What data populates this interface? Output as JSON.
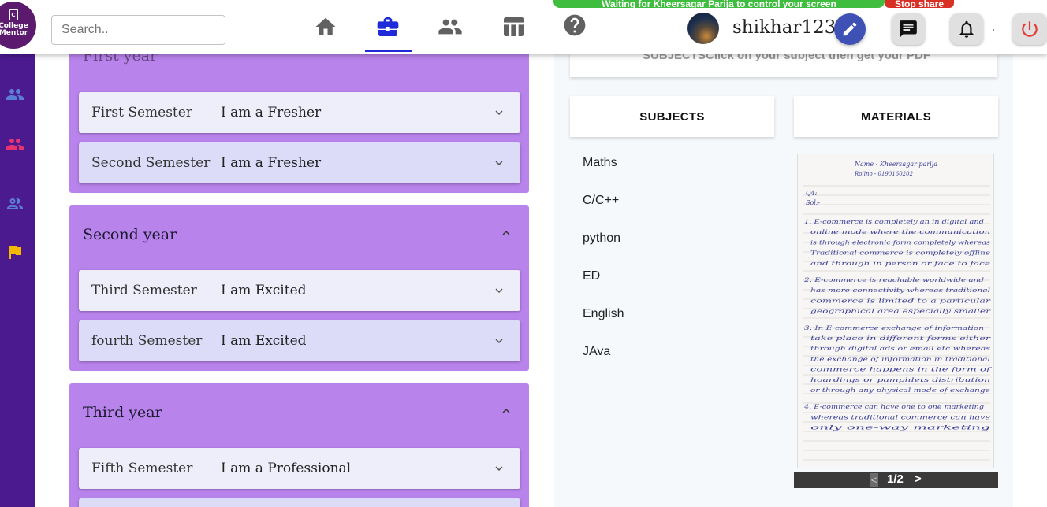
{
  "brand": {
    "logo_text": "College Mentor",
    "logo_line1": "College",
    "logo_line2": "Mentor"
  },
  "search": {
    "placeholder": "Search.."
  },
  "nav": {
    "items": [
      {
        "icon": "home-icon",
        "active": false
      },
      {
        "icon": "briefcase-icon",
        "active": true
      },
      {
        "icon": "people-icon",
        "active": false
      },
      {
        "icon": "dashboard-icon",
        "active": false
      },
      {
        "icon": "help-icon",
        "active": false
      }
    ]
  },
  "screen_share": {
    "message": "Waiting for Kheersagar Parija to control your screen",
    "stop_label": "Stop share"
  },
  "user": {
    "name": "shikhar123"
  },
  "header_actions": [
    "edit-icon",
    "chat-icon",
    "bell-icon",
    "power-icon"
  ],
  "sidebar": {
    "icons": [
      "group-icon",
      "group-icon",
      "group-outline-icon",
      "flag-icon"
    ]
  },
  "years": [
    {
      "title": "First year",
      "expanded": true,
      "semesters": [
        {
          "name": "First Semester",
          "status": "I am a Fresher"
        },
        {
          "name": "Second Semester",
          "status": "I am a Fresher"
        }
      ]
    },
    {
      "title": "Second year",
      "expanded": true,
      "semesters": [
        {
          "name": "Third Semester",
          "status": "I am Excited"
        },
        {
          "name": "fourth Semester",
          "status": "I am Excited"
        }
      ]
    },
    {
      "title": "Third year",
      "expanded": true,
      "semesters": [
        {
          "name": "Fifth Semester",
          "status": "I am a Professional"
        }
      ]
    }
  ],
  "right_panel": {
    "hint": "SUBJECTSClick on your subject then get your PDF",
    "subjects_header": "SUBJECTS",
    "materials_header": "MATERIALS",
    "subjects": [
      "Maths",
      "C/C++",
      "python",
      "ED",
      "English",
      "JAva"
    ],
    "pager": {
      "prev": "<",
      "page": "1/2",
      "next": ">"
    }
  },
  "document": {
    "header_line1": "Name - Kheersagar parija",
    "header_line2": "Rollno - 0190160202",
    "q": "Q4:",
    "sol": "Sol:-",
    "lines": [
      "1. E-commerce is completely an in digital and",
      "online mode where the communication",
      "is through electronic form completely whereas",
      "Traditional commerce is completely offline",
      "and through in person or face to face",
      "2. E-commerce is reachable worldwide and",
      "has more connectivity whereas traditional",
      "commerce is limited to a particular",
      "geographical area especially smaller",
      "3. In E-commerce exchange of information",
      "take place in different forms either",
      "through digital ads or email etc whereas",
      "the exchange of information in traditional",
      "commerce happens in the form of",
      "hoardings or pamphlets distribution",
      "or through any physical mode of exchange",
      "4. E-commerce can have one to one marketing",
      "whereas traditional commerce can have",
      "only one-way marketing"
    ]
  },
  "colors": {
    "sidebar": "#4b1a8f",
    "year_card": "#b983ec",
    "nav_active": "#1e2bd6",
    "edit_button": "#3f51b5",
    "power": "#e53935",
    "banner": "#3fbd3f",
    "stop_button": "#d93025"
  }
}
